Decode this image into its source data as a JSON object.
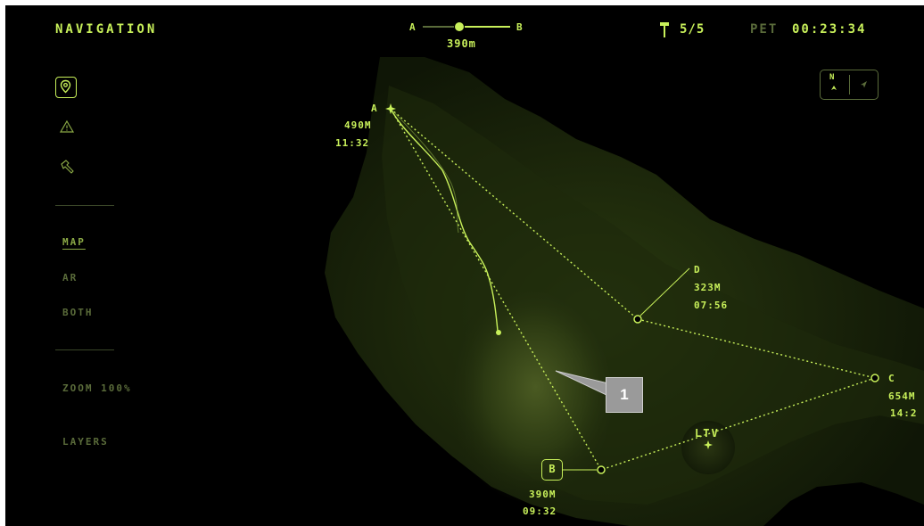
{
  "header": {
    "title": "NAVIGATION",
    "route_start": "A",
    "route_end": "B",
    "route_distance": "390m",
    "waypoint_count": "5/5",
    "pet_label": "PET",
    "pet_time": "00:23:34"
  },
  "sidebar": {
    "modes": [
      {
        "label": "MAP"
      },
      {
        "label": "AR"
      },
      {
        "label": "BOTH"
      }
    ],
    "zoom_label": "ZOOM 100%",
    "layers_label": "LAYERS"
  },
  "compass": {
    "north_label": "N"
  },
  "waypoints": {
    "a": {
      "name": "A",
      "distance": "490M",
      "time": "11:32"
    },
    "b": {
      "name": "B",
      "distance": "390M",
      "time": "09:32"
    },
    "c": {
      "name": "C",
      "distance": "654M",
      "time": "14:2"
    },
    "d": {
      "name": "D",
      "distance": "323M",
      "time": "07:56"
    }
  },
  "vehicle_label": "LTV",
  "callout_label": "1",
  "colors": {
    "accent": "#c8f05a",
    "dim": "#5a6b3a",
    "background": "#000000",
    "terrain": "#1e2a0c"
  }
}
